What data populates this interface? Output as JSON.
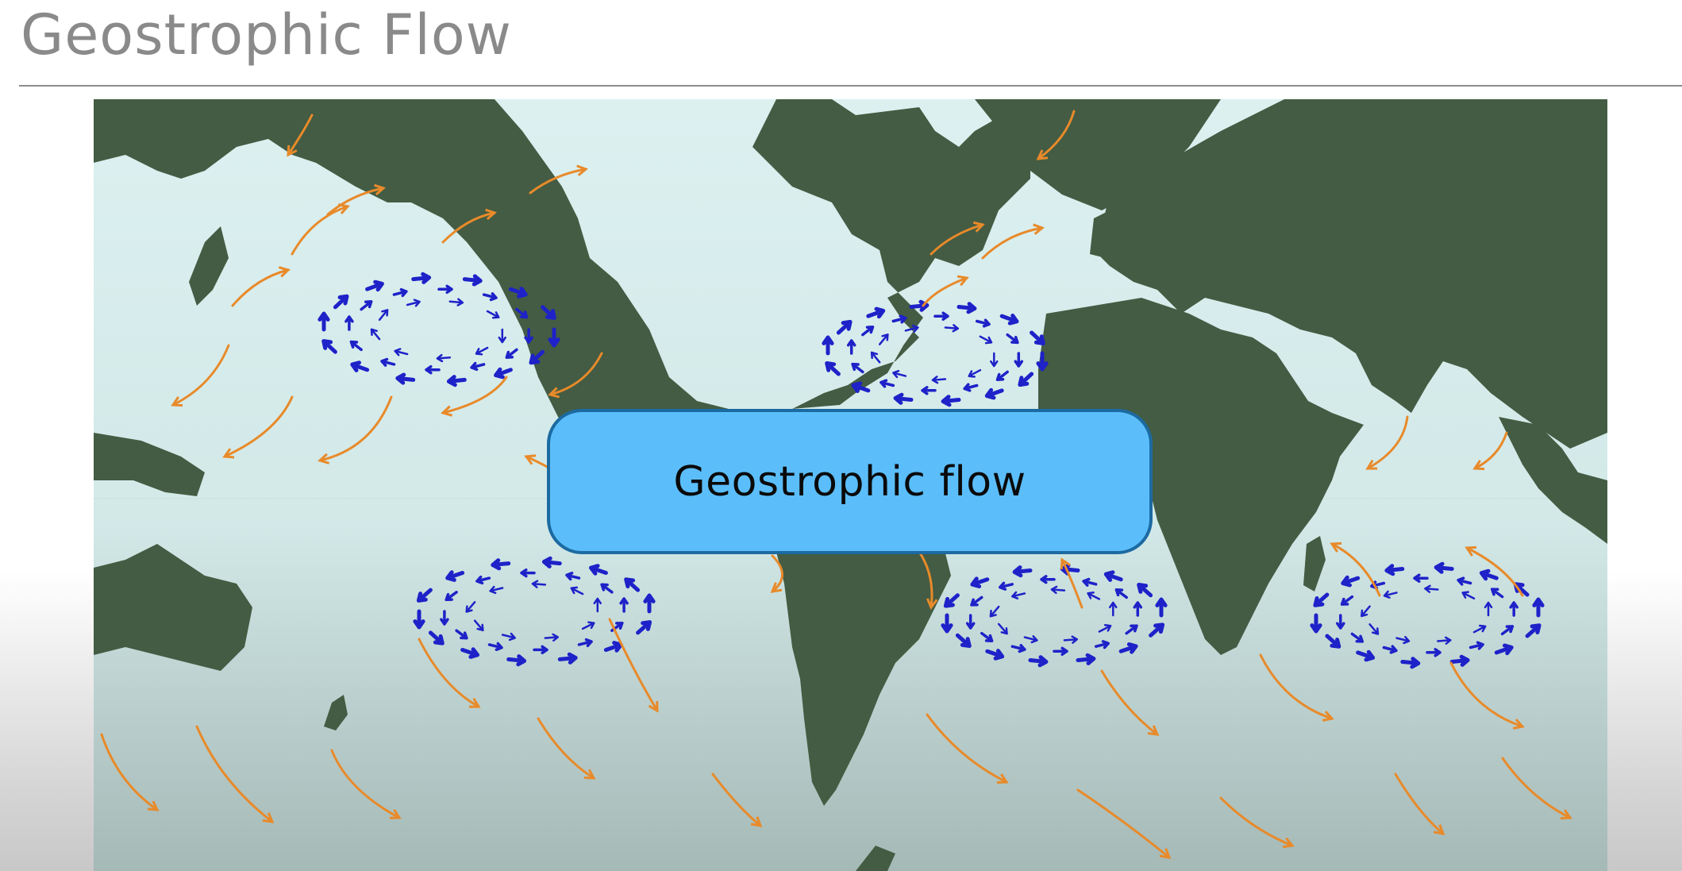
{
  "slide": {
    "title": "Geostrophic Flow"
  },
  "diagram": {
    "label": "Geostrophic flow"
  },
  "colors": {
    "land": "#435c43",
    "ocean_top": "#dcf0f0",
    "ocean_bottom": "#a5b9b6",
    "gyre_arrows": "#1e22c8",
    "wind_arrows": "#e88a2a",
    "label_fill": "#5bbefa",
    "label_border": "#1c6aa2"
  },
  "icons": {
    "gyre_arrow": "dark-blue-arrow",
    "wind_arrow": "orange-curved-arrow"
  }
}
